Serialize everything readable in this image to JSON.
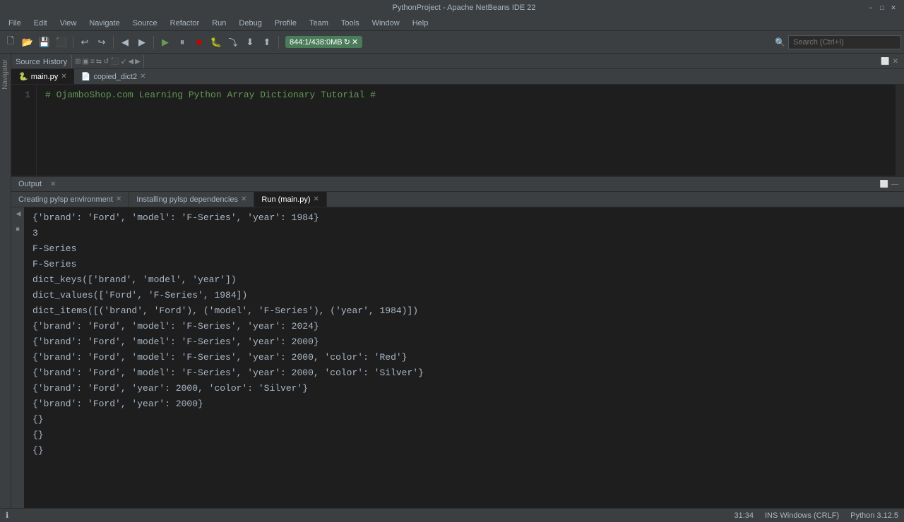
{
  "titleBar": {
    "title": "PythonProject - Apache NetBeans IDE 22",
    "minBtn": "−",
    "maxBtn": "□",
    "closeBtn": "✕"
  },
  "menuBar": {
    "items": [
      "File",
      "Edit",
      "View",
      "Navigate",
      "Source",
      "Refactor",
      "Run",
      "Debug",
      "Profile",
      "Team",
      "Tools",
      "Window",
      "Help"
    ]
  },
  "toolbar": {
    "runGroupLabel": "844:1/438:0MB",
    "searchPlaceholder": "Search (Ctrl+I)"
  },
  "editorTabs": {
    "mainTab": "main.py",
    "copiedTab": "copied_dict2",
    "sourceBtnLabel": "Source",
    "historyBtnLabel": "History"
  },
  "editorContent": {
    "lineNumber": "1",
    "codeLine": "# OjamboShop.com Learning Python Array Dictionary Tutorial #"
  },
  "subTabs": {
    "mainPy": "main.py",
    "copiedDict2": "copied_dict2"
  },
  "outputSection": {
    "title": "Output",
    "tabs": [
      {
        "label": "Creating pylsp environment",
        "closable": true
      },
      {
        "label": "Installing pylsp dependencies",
        "closable": true
      },
      {
        "label": "Run (main.py)",
        "closable": true,
        "active": true
      }
    ]
  },
  "outputLines": [
    "{'brand': 'Ford', 'model': 'F-Series', 'year': 1984}",
    "3",
    "F-Series",
    "F-Series",
    "dict_keys(['brand', 'model', 'year'])",
    "dict_values(['Ford', 'F-Series', 1984])",
    "dict_items([('brand', 'Ford'), ('model', 'F-Series'), ('year', 1984)])",
    "{'brand': 'Ford', 'model': 'F-Series', 'year': 2024}",
    "{'brand': 'Ford', 'model': 'F-Series', 'year': 2000}",
    "{'brand': 'Ford', 'model': 'F-Series', 'year': 2000, 'color': 'Red'}",
    "{'brand': 'Ford', 'model': 'F-Series', 'year': 2000, 'color': 'Silver'}",
    "{'brand': 'Ford', 'year': 2000, 'color': 'Silver'}",
    "{'brand': 'Ford', 'year': 2000}",
    "{}",
    "{}",
    "{}"
  ],
  "statusBar": {
    "position": "31:34",
    "encoding": "INS Windows (CRLF)",
    "pythonVersion": "Python 3.12.5"
  }
}
